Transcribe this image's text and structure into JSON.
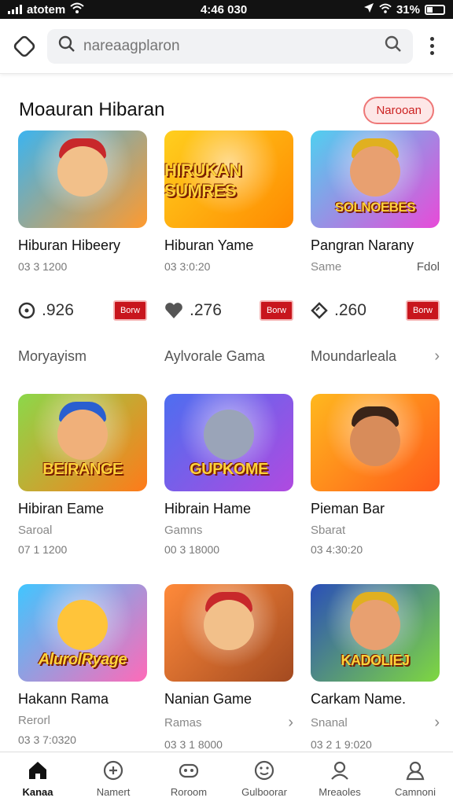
{
  "status_bar": {
    "carrier": "atotem",
    "time": "4:46 030",
    "battery": "31%"
  },
  "search": {
    "placeholder": "nareaagplaron"
  },
  "section": {
    "title": "Moauran Hibaran",
    "pill": "Narooan"
  },
  "row1": [
    {
      "title": "Hiburan Hibeery",
      "sub": "",
      "num": "03 3 1200",
      "extra": "",
      "banner": "",
      "colors": [
        "#3bb4f0",
        "#ff9a2e"
      ]
    },
    {
      "title": "Hiburan Yame",
      "sub": "",
      "num": "03 3:0:20",
      "extra": "",
      "banner": "HIRUKAN SUMRES",
      "colors": [
        "#ffcf1e",
        "#ff8a00"
      ]
    },
    {
      "title": "Pangran Narany",
      "sub": "Same",
      "num": "",
      "extra": "Fdol",
      "banner": "SOLNOEBES",
      "colors": [
        "#4fd0f0",
        "#e84ad8"
      ]
    }
  ],
  "stats": [
    {
      "icon": "clock-icon",
      "value": ".926",
      "tag": "Borw"
    },
    {
      "icon": "heart-icon",
      "value": ".276",
      "tag": "Borw"
    },
    {
      "icon": "gem-icon",
      "value": ".260",
      "tag": "Borw"
    }
  ],
  "categories": [
    {
      "label": "Moryayism",
      "chevron": false
    },
    {
      "label": "Aylvorale Gama",
      "chevron": false
    },
    {
      "label": "Moundarleala",
      "chevron": true
    }
  ],
  "row2": [
    {
      "title": "Hibiran Eame",
      "sub": "Saroal",
      "num": "07 1 1200",
      "extra": "",
      "banner": "BEIRANGE",
      "colors": [
        "#8bd84a",
        "#ff7a1a"
      ]
    },
    {
      "title": "Hibrain Hame",
      "sub": "Gamns",
      "num": "00 3 18000",
      "extra": "",
      "banner": "GUPKOME",
      "colors": [
        "#4d6ef0",
        "#b04ae0"
      ]
    },
    {
      "title": "Pieman Bar",
      "sub": "Sbarat",
      "num": "03 4:30:20",
      "extra": "",
      "banner": "",
      "colors": [
        "#ffb81e",
        "#ff5a1a"
      ]
    }
  ],
  "row3": [
    {
      "title": "Hakann Rama",
      "sub": "Rerorl",
      "num": "03 3 7:0320",
      "extra": "",
      "banner": "AlurolRyage",
      "colors": [
        "#40c6ff",
        "#ff6ab8"
      ]
    },
    {
      "title": "Nanian Game",
      "sub": "Ramas",
      "num": "03 3 1 8000",
      "extra": "›",
      "banner": "",
      "colors": [
        "#ff8a3a",
        "#a34a20"
      ]
    },
    {
      "title": "Carkam Name.",
      "sub": "Snanal",
      "num": "03 2 1 9:020",
      "extra": "›",
      "banner": "KADOLIEJ",
      "colors": [
        "#2a4fb8",
        "#7fd840"
      ]
    }
  ],
  "row4": [
    {
      "colors": [
        "#ff9a2e",
        "#ffce3a"
      ]
    },
    {
      "colors": [
        "#3b7cf0",
        "#ffd33a"
      ]
    },
    {
      "colors": [
        "#1a4aa8",
        "#3be0f0"
      ]
    }
  ],
  "nav": [
    {
      "label": "Kanaa",
      "icon": "home-icon",
      "active": true
    },
    {
      "label": "Namert",
      "icon": "gamepad-icon",
      "active": false
    },
    {
      "label": "Roroom",
      "icon": "controller-icon",
      "active": false
    },
    {
      "label": "Gulboorar",
      "icon": "smiley-icon",
      "active": false
    },
    {
      "label": "Mreaoles",
      "icon": "user-icon",
      "active": false
    },
    {
      "label": "Camnoni",
      "icon": "profile-icon",
      "active": false
    }
  ]
}
